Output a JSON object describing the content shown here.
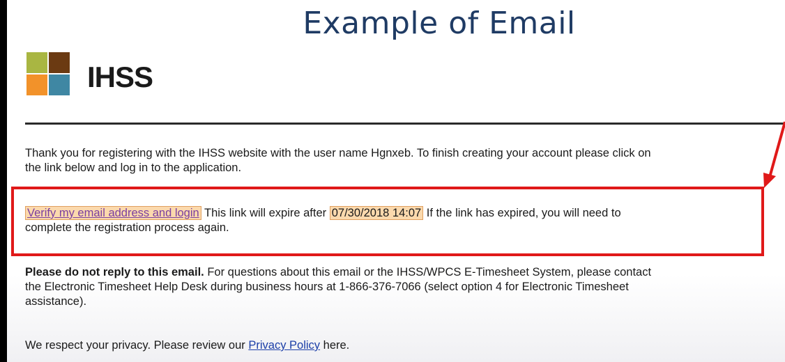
{
  "slide": {
    "title": "Example of Email"
  },
  "logo": {
    "text": "IHSS",
    "colors": [
      "#a9b642",
      "#6b3a12",
      "#f2922a",
      "#3f87a3"
    ]
  },
  "email": {
    "intro_line1": "Thank you for registering with the IHSS website with the user name Hgnxeb. To finish creating your account please click on",
    "intro_line2": "the link below and log in to the application.",
    "verify_link": "Verify my email address and login",
    "expire_pre": "This link will expire after",
    "expire_date": "07/30/2018 14:07",
    "expire_post": "If the link has expired, you will need to",
    "expire_line2": "complete the registration process again.",
    "noreply_bold": "Please do not reply to this email.",
    "noreply_rest": "For questions about this email or the IHSS/WPCS E-Timesheet System, please contact",
    "helpdesk_line2": "the Electronic Timesheet Help Desk during business hours at 1-866-376-7066 (select option 4 for Electronic Timesheet",
    "helpdesk_line3": "assistance).",
    "privacy_pre": "We respect your privacy. Please review our",
    "privacy_link": "Privacy Policy",
    "privacy_post": "here."
  },
  "annotation": {
    "highlight_color": "#e01919"
  }
}
